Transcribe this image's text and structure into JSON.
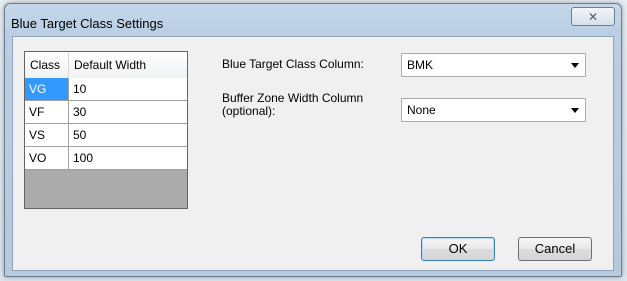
{
  "dialog": {
    "title": "Blue Target Class Settings",
    "close_glyph": "✕"
  },
  "grid": {
    "headers": [
      "Class",
      "Default Width"
    ],
    "rows": [
      {
        "class": "VG",
        "width": "10"
      },
      {
        "class": "VF",
        "width": "30"
      },
      {
        "class": "VS",
        "width": "50"
      },
      {
        "class": "VO",
        "width": "100"
      }
    ],
    "selected_row": 0
  },
  "settings": {
    "target_column_label": "Blue Target Class Column:",
    "target_column_value": "BMK",
    "buffer_label_line1": "Buffer Zone Width Column",
    "buffer_label_line2": "(optional):",
    "buffer_value": "None"
  },
  "buttons": {
    "ok": "OK",
    "cancel": "Cancel"
  },
  "colors": {
    "selection": "#3399ff",
    "default_button_border": "#3c7fb1"
  }
}
